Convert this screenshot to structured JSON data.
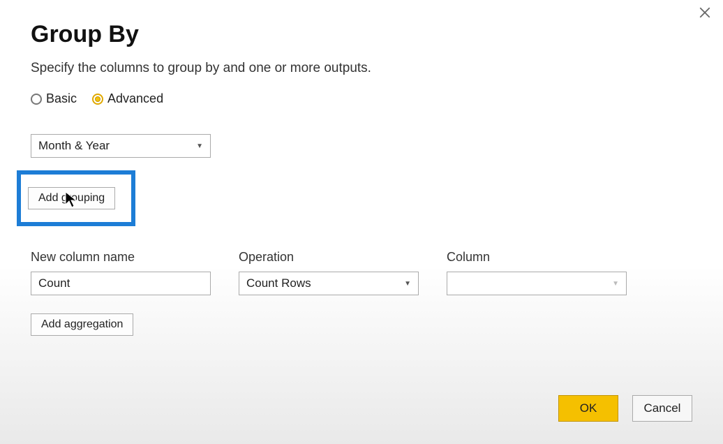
{
  "dialog": {
    "title": "Group By",
    "subtitle": "Specify the columns to group by and one or more outputs."
  },
  "mode": {
    "basic_label": "Basic",
    "advanced_label": "Advanced",
    "selected": "advanced"
  },
  "grouping": {
    "column_select_value": "Month & Year",
    "add_button_label": "Add grouping"
  },
  "aggregation": {
    "new_column_label": "New column name",
    "new_column_value": "Count",
    "operation_label": "Operation",
    "operation_value": "Count Rows",
    "column_label": "Column",
    "column_value": "",
    "add_button_label": "Add aggregation"
  },
  "footer": {
    "ok_label": "OK",
    "cancel_label": "Cancel"
  }
}
